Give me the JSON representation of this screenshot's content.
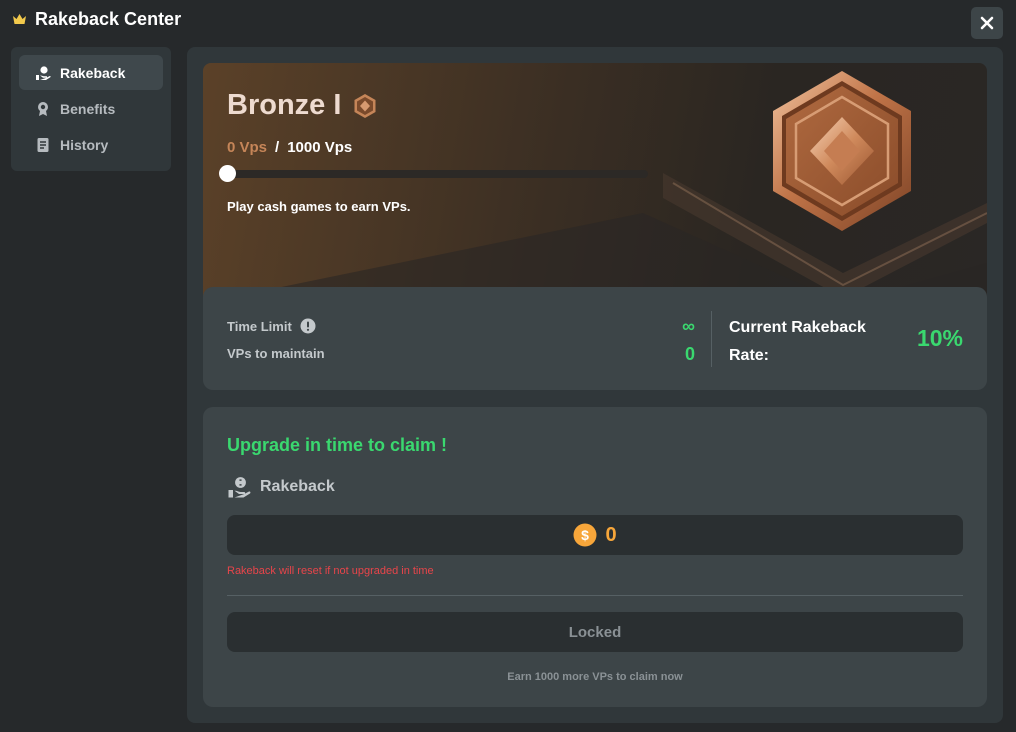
{
  "app": {
    "title": "Rakeback Center"
  },
  "sidebar": {
    "items": [
      {
        "label": "Rakeback",
        "icon": "hand-coin-icon",
        "active": true
      },
      {
        "label": "Benefits",
        "icon": "medal-icon",
        "active": false
      },
      {
        "label": "History",
        "icon": "document-icon",
        "active": false
      }
    ]
  },
  "tier": {
    "name": "Bronze I",
    "vps_current": "0 Vps",
    "separator": "/",
    "vps_target": "1000 Vps",
    "progress": 0,
    "hint": "Play cash games to earn VPs."
  },
  "stats": {
    "time_limit_label": "Time Limit",
    "time_limit_value": "∞",
    "vps_maintain_label": "VPs to maintain",
    "vps_maintain_value": "0",
    "rate_label": "Current Rakeback Rate:",
    "rate_value": "10%"
  },
  "claim": {
    "heading": "Upgrade in time to claim !",
    "section_label": "Rakeback",
    "amount": "0",
    "warning": "Rakeback will reset if not upgraded in time",
    "button_label": "Locked",
    "note": "Earn 1000 more VPs to claim now"
  },
  "colors": {
    "accent_green": "#3ad86f",
    "bronze": "#c58558",
    "coin": "#f7a63a",
    "warning": "#e8454a",
    "panel": "#30373a",
    "card": "#3d4548"
  }
}
